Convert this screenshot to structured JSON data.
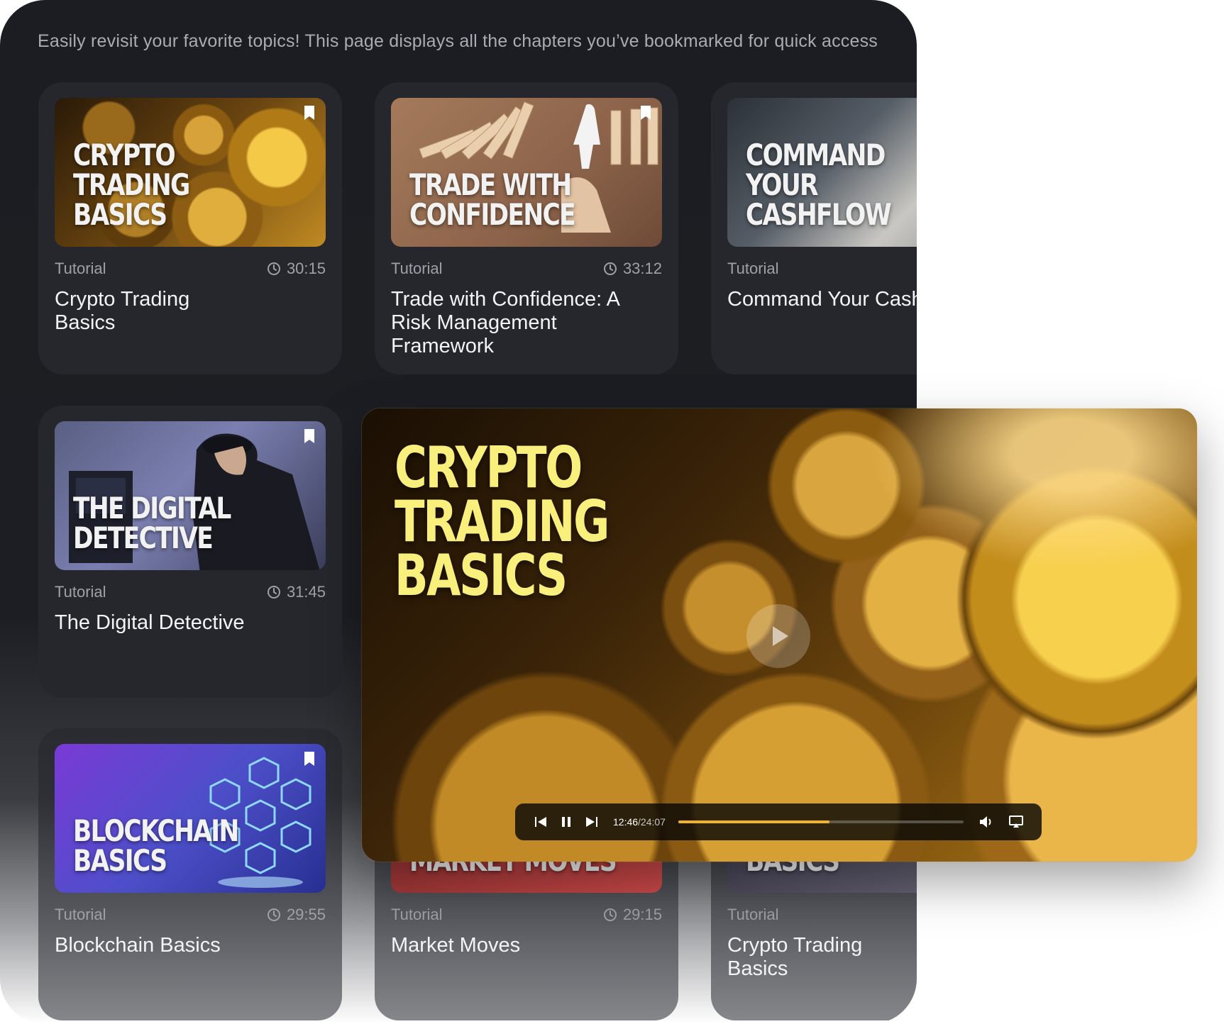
{
  "intro": "Easily revisit your favorite topics! This page displays all the chapters you’ve bookmarked for quick access",
  "cards": [
    {
      "thumb": "CRYPTO\nTRADING\nBASICS",
      "category": "Tutorial",
      "duration": "30:15",
      "title": "Crypto Trading Basics"
    },
    {
      "thumb": "TRADE WITH\nCONFIDENCE",
      "category": "Tutorial",
      "duration": "33:12",
      "title": "Trade with Confidence: A Risk Management Framework"
    },
    {
      "thumb": "COMMAND\nYOUR\nCASHFLOW",
      "category": "Tutorial",
      "duration": "",
      "title": "Command Your Cashflow"
    },
    {
      "thumb": "THE DIGITAL\nDETECTIVE",
      "category": "Tutorial",
      "duration": "31:45",
      "title": "The Digital Detective"
    },
    {
      "thumb": "BLOCKCHAIN\nBASICS",
      "category": "Tutorial",
      "duration": "29:55",
      "title": "Blockchain Basics"
    },
    {
      "thumb": "MARKET MOVES",
      "category": "Tutorial",
      "duration": "29:15",
      "title": "Market Moves"
    },
    {
      "thumb": "BASICS",
      "category": "Tutorial",
      "duration": "",
      "title": "Crypto Trading Basics"
    }
  ],
  "player": {
    "title": "CRYPTO\nTRADING\nBASICS",
    "current_time": "12:46",
    "total_time": "/24:07",
    "progress_fraction": 0.53,
    "accent": "#f0b429",
    "icons": [
      "skip-back-icon",
      "pause-icon",
      "skip-forward-icon",
      "volume-icon",
      "airplay-icon",
      "play-icon"
    ]
  }
}
